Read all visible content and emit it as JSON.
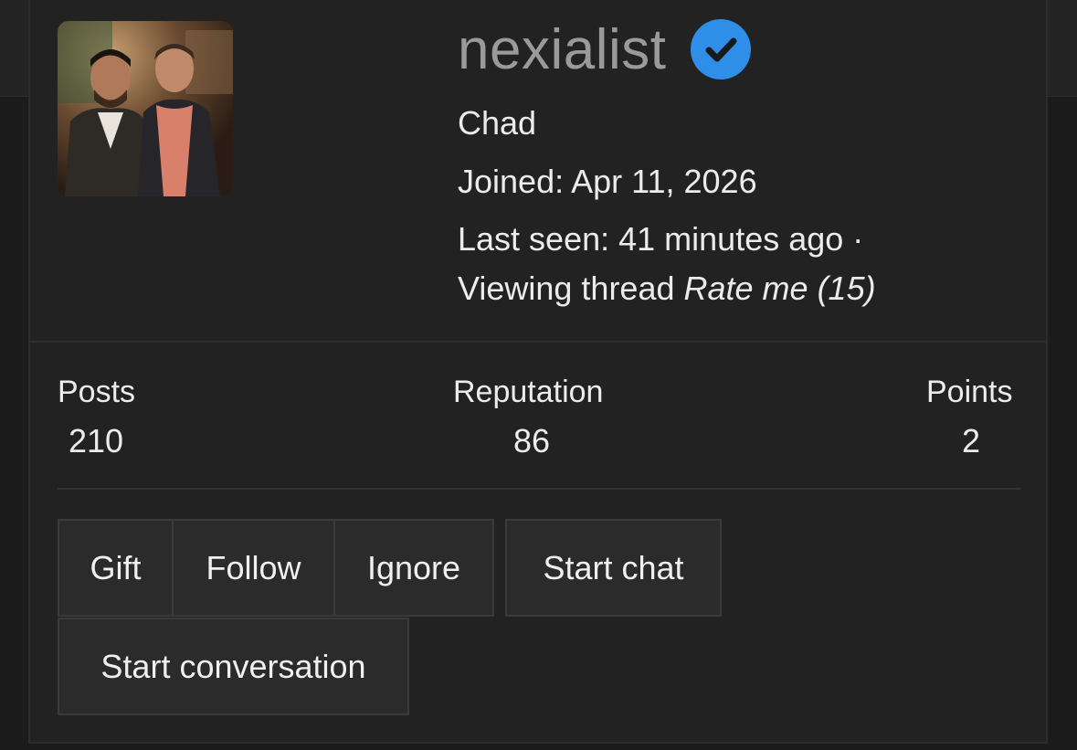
{
  "profile": {
    "username": "nexialist",
    "verified_icon": "verified-check-icon",
    "title": "Chad",
    "joined": "Joined: Apr 11, 2026",
    "last_seen": "Last seen: 41 minutes ago ·",
    "activity_prefix": "Viewing thread",
    "activity_thread": "Rate me (15)",
    "avatar_icon": "user-avatar-photo"
  },
  "stats": {
    "posts_label": "Posts",
    "posts_value": "210",
    "reputation_label": "Reputation",
    "reputation_value": "86",
    "points_label": "Points",
    "points_value": "2"
  },
  "actions": {
    "gift": "Gift",
    "follow": "Follow",
    "ignore": "Ignore",
    "start_chat": "Start chat",
    "start_conversation": "Start conversation"
  },
  "colors": {
    "background": "#1c1c1c",
    "card": "#222222",
    "username": "#9a9a9a",
    "verified": "#2f8fe8",
    "button": "#2b2b2b"
  }
}
